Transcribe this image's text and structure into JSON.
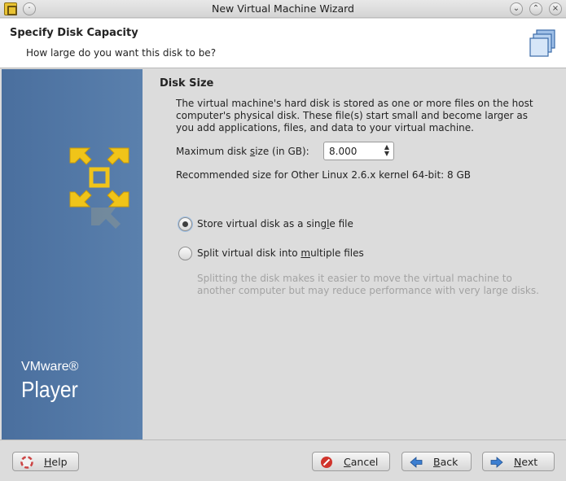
{
  "window": {
    "title": "New Virtual Machine Wizard"
  },
  "header": {
    "title": "Specify Disk Capacity",
    "subtitle": "How large do you want this disk to be?"
  },
  "sidebar": {
    "brand_top": "VMware®",
    "brand_bottom": "Player"
  },
  "section": {
    "title": "Disk Size",
    "description": "The virtual machine's hard disk is stored as one or more files on the host computer's physical disk. These file(s) start small and become larger as you add applications, files, and data to your virtual machine.",
    "max_size_label_pre": "Maximum disk ",
    "max_size_label_key": "s",
    "max_size_label_post": "ize (in GB):",
    "max_size_value": "8.000",
    "recommended": "Recommended size for Other Linux 2.6.x kernel 64-bit: 8 GB"
  },
  "options": {
    "single": {
      "pre": "Store virtual disk as a sing",
      "key": "l",
      "post": "e file",
      "selected": true
    },
    "split": {
      "pre": "Split virtual disk into ",
      "key": "m",
      "post": "ultiple files",
      "selected": false
    },
    "split_description": "Splitting the disk makes it easier to move the virtual machine to another computer but may reduce performance with very large disks."
  },
  "buttons": {
    "help": {
      "key": "H",
      "rest": "elp"
    },
    "cancel": {
      "key": "C",
      "rest": "ancel"
    },
    "back": {
      "key": "B",
      "rest": "ack"
    },
    "next": {
      "key": "N",
      "rest": "ext"
    }
  },
  "colors": {
    "sidebar": "#4f75a4",
    "logo": "#f0c419",
    "cancel_icon": "#d0342c",
    "arrow_icon": "#3d7fd1"
  }
}
